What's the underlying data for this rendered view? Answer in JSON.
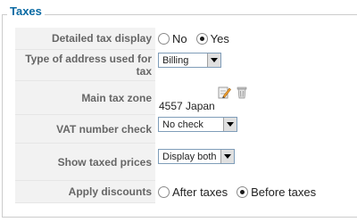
{
  "section": {
    "legend": "Taxes"
  },
  "rows": [
    {
      "label": "Detailed tax display",
      "options": [
        "No",
        "Yes"
      ],
      "selected": "Yes"
    },
    {
      "label": "Type of address used for tax",
      "value": "Billing"
    },
    {
      "label": "Main tax zone",
      "value": "4557 Japan",
      "icons": [
        "edit-icon",
        "delete-icon"
      ]
    },
    {
      "label": "VAT number check",
      "value": "No check"
    },
    {
      "label": "Show taxed prices",
      "value": "Display both"
    },
    {
      "label": "Apply discounts",
      "options": [
        "After taxes",
        "Before taxes"
      ],
      "selected": "Before taxes"
    }
  ]
}
